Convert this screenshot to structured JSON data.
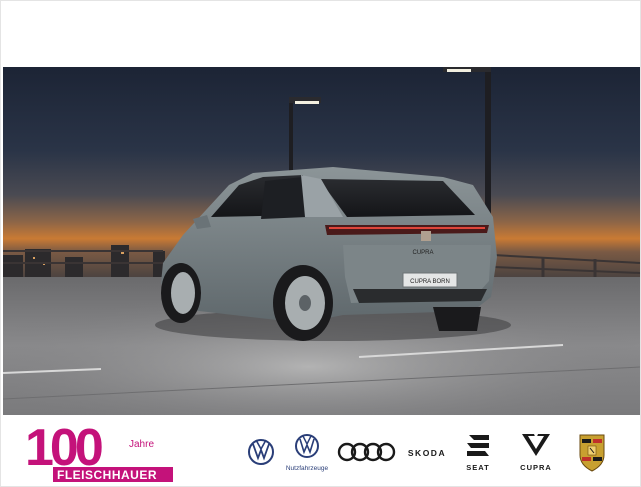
{
  "car": {
    "plate_text": "CUPRA BORN",
    "wordmark": "CUPRA"
  },
  "dealer": {
    "anniversary_number": "100",
    "anniversary_word": "Jahre",
    "name": "FLEISCHHAUER",
    "colors": {
      "magenta": "#c4127a",
      "dark": "#7a1454"
    }
  },
  "brands": [
    {
      "name": "Volkswagen",
      "icon": "vw-logo-icon",
      "caption": ""
    },
    {
      "name": "Volkswagen Nutzfahrzeuge",
      "icon": "vw-logo-icon",
      "caption": "Nutzfahrzeuge"
    },
    {
      "name": "Audi",
      "icon": "audi-rings-icon",
      "caption": ""
    },
    {
      "name": "Skoda",
      "icon": "",
      "caption": "SKODA"
    },
    {
      "name": "Seat",
      "icon": "seat-s-icon",
      "caption": "SEAT"
    },
    {
      "name": "Cupra",
      "icon": "cupra-triangle-icon",
      "caption": "CUPRA"
    },
    {
      "name": "Porsche",
      "icon": "porsche-crest-icon",
      "caption": ""
    }
  ]
}
